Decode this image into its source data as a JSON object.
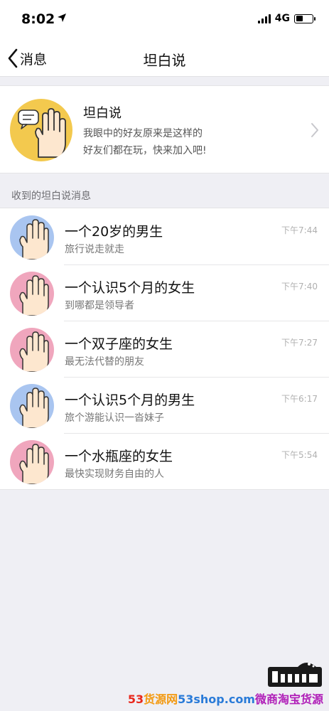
{
  "status_bar": {
    "time": "8:02",
    "network": "4G"
  },
  "nav": {
    "back_label": "消息",
    "title": "坦白说"
  },
  "feature": {
    "title": "坦白说",
    "line1": "我眼中的好友原来是这样的",
    "line2": "好友们都在玩，快来加入吧!"
  },
  "section": {
    "header": "收到的坦白说消息"
  },
  "messages": [
    {
      "title": "一个20岁的男生",
      "subtitle": "旅行说走就走",
      "time": "下午7:44",
      "avatar_color": "#a9c5f0"
    },
    {
      "title": "一个认识5个月的女生",
      "subtitle": "到哪都是领导者",
      "time": "下午7:40",
      "avatar_color": "#f0a6bd"
    },
    {
      "title": "一个双子座的女生",
      "subtitle": "最无法代替的朋友",
      "time": "下午7:27",
      "avatar_color": "#f0a6bd"
    },
    {
      "title": "一个认识5个月的男生",
      "subtitle": "旅个游能认识一沓妹子",
      "time": "下午6:17",
      "avatar_color": "#a9c5f0"
    },
    {
      "title": "一个水瓶座的女生",
      "subtitle": "最快实现财务自由的人",
      "time": "下午5:54",
      "avatar_color": "#f0a6bd"
    }
  ],
  "watermark": {
    "part1": "53",
    "part2": "货源网",
    "part3": "53shop.com",
    "part4": "微商淘宝货源"
  },
  "colors": {
    "background": "#efeff4",
    "feature_avatar": "#f3c94e",
    "boy_avatar": "#a9c5f0",
    "girl_avatar": "#f0a6bd"
  }
}
